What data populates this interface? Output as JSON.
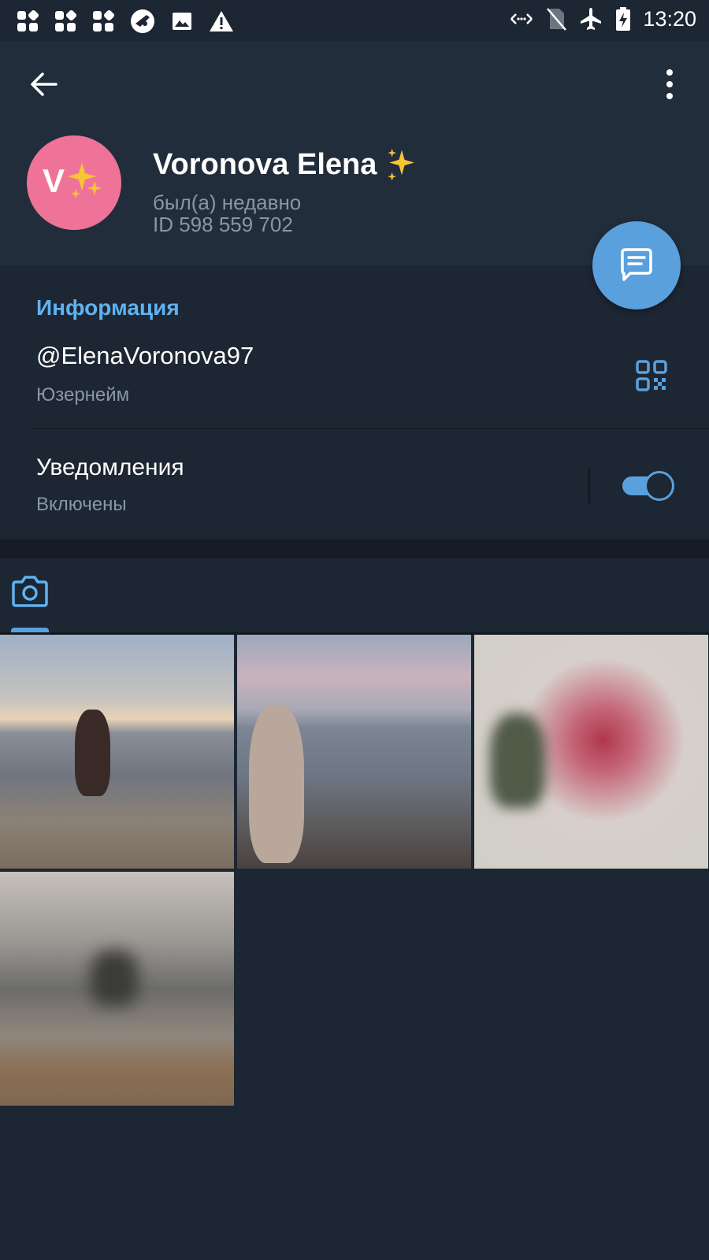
{
  "status_bar": {
    "time": "13:20",
    "left_icons": [
      "app-grid-icon",
      "app-grid-icon",
      "app-grid-icon",
      "browser-icon",
      "image-icon",
      "warning-icon"
    ],
    "right_icons": [
      "data-transfer-icon",
      "no-sim-icon",
      "airplane-icon",
      "battery-charging-icon"
    ]
  },
  "profile": {
    "avatar_letter": "V",
    "name": "Voronova Elena",
    "name_emoji": "✨",
    "last_seen": "был(а) недавно",
    "user_id": "ID 598 559 702",
    "avatar_color": "#ef7399"
  },
  "info": {
    "section_title": "Информация",
    "username": "@ElenaVoronova97",
    "username_label": "Юзернейм",
    "notifications_title": "Уведомления",
    "notifications_state": "Включены",
    "notifications_enabled": true
  },
  "media": {
    "active_tab": "photos",
    "photos": [
      {
        "description_icon": "photo-beach-1"
      },
      {
        "description_icon": "photo-beach-2"
      },
      {
        "description_icon": "photo-blurred-3"
      },
      {
        "description_icon": "photo-blurred-4"
      }
    ]
  },
  "colors": {
    "accent": "#5aa0dd",
    "section_title": "#5fb2f0",
    "background": "#1d2633",
    "header": "#222d3b",
    "secondary_text": "#8b96a4"
  }
}
